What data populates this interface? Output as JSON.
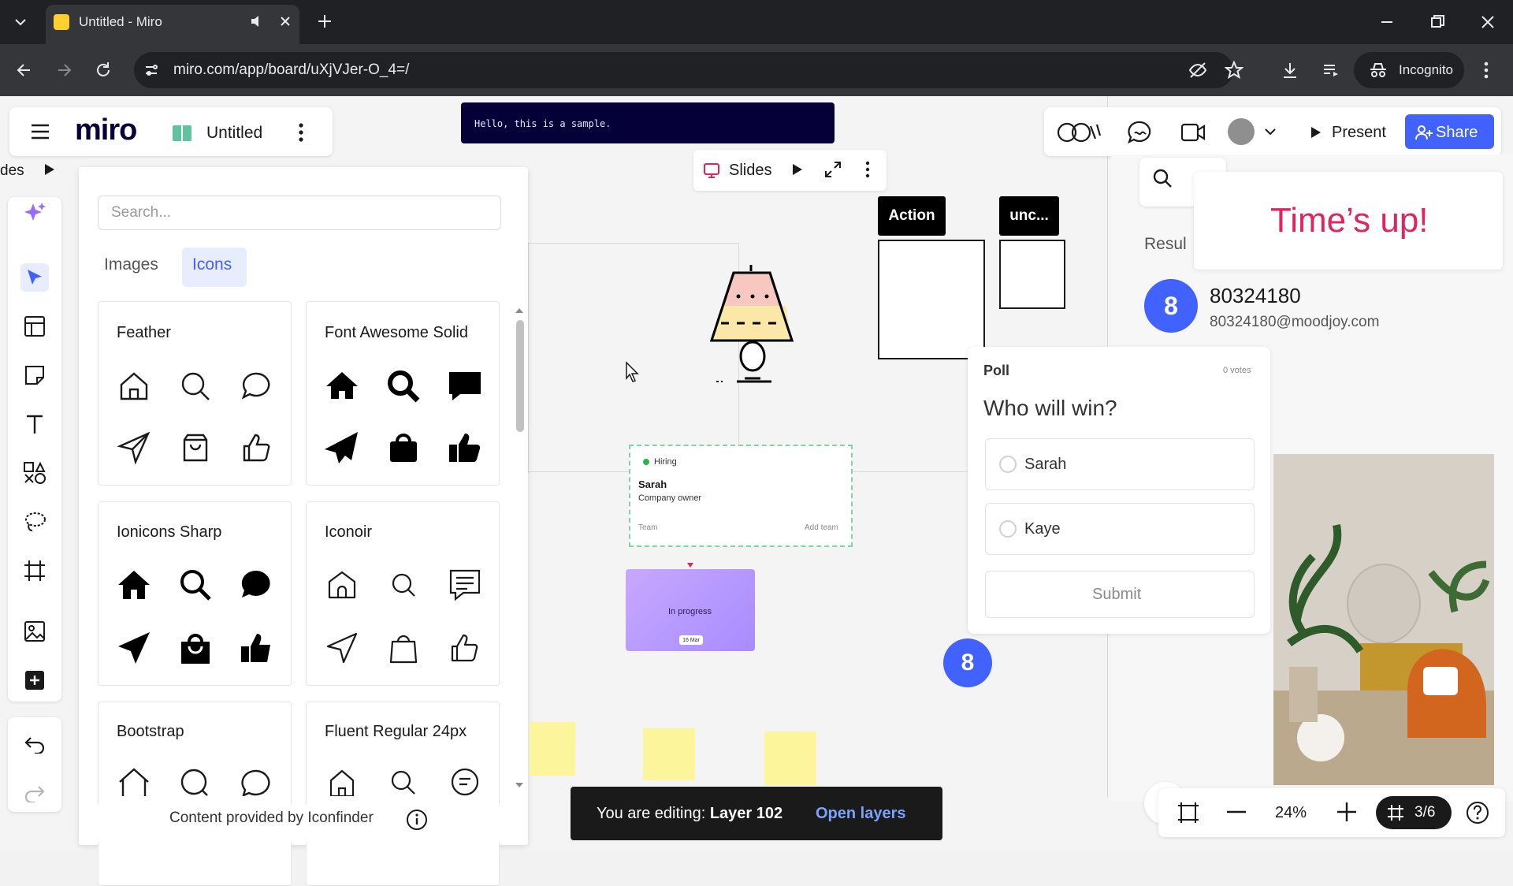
{
  "browser": {
    "tab_title": "Untitled - Miro",
    "url": "miro.com/app/board/uXjVJer-O_4=/",
    "incognito_label": "Incognito"
  },
  "header": {
    "logo": "miro",
    "board_title": "Untitled",
    "code_banner": "Hello, this is a sample.",
    "left_fragment": "des",
    "present_label": "Present",
    "share_label": "Share"
  },
  "icon_panel": {
    "search_placeholder": "Search...",
    "tabs": [
      {
        "label": "Images"
      },
      {
        "label": "Icons"
      }
    ],
    "sets": [
      {
        "name": "Feather"
      },
      {
        "name": "Font Awesome Solid"
      },
      {
        "name": "Ionicons Sharp"
      },
      {
        "name": "Iconoir"
      },
      {
        "name": "Bootstrap"
      },
      {
        "name": "Fluent Regular 24px"
      }
    ],
    "footer": "Content provided by Iconfinder"
  },
  "slides": {
    "label": "Slides"
  },
  "board": {
    "tags": {
      "action": "Action",
      "unc": "unc..."
    },
    "hiring_card": {
      "badge": "Hiring",
      "name": "Sarah",
      "role": "Company owner",
      "left": "Team",
      "right": "Add team"
    },
    "progress_card": {
      "label": "In progress",
      "chip": "16 Mar"
    },
    "avatar_number": "8"
  },
  "poll": {
    "title": "Poll",
    "votes": "0 votes",
    "question": "Who will win?",
    "options": [
      {
        "label": "Sarah"
      },
      {
        "label": "Kaye"
      }
    ],
    "submit_label": "Submit"
  },
  "results": {
    "title": "Resul",
    "times_up": "Time’s up!",
    "user_id": "80324180",
    "user_email": "80324180@moodjoy.com",
    "avatar": "8"
  },
  "status": {
    "editing_prefix": "You are editing:",
    "layer": "Layer 102",
    "open_layers": "Open layers"
  },
  "zoom": {
    "level": "24%",
    "pages": "3/6"
  },
  "colors": {
    "accent": "#4262ff",
    "dark": "#050038",
    "alert": "#e0245e",
    "sticky": "#fdf59b"
  }
}
